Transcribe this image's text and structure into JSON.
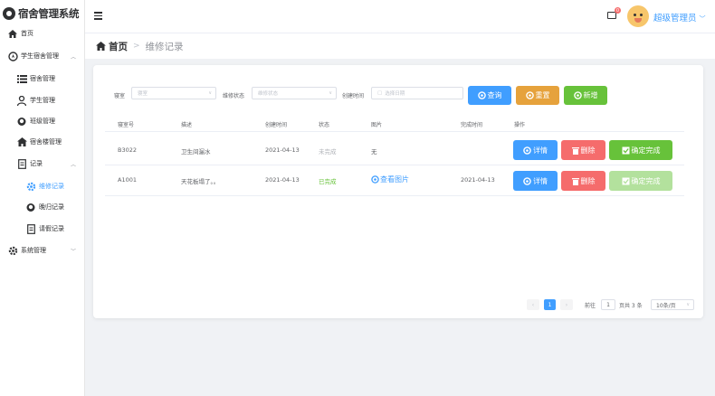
{
  "app": {
    "title": "宿舍管理系统"
  },
  "sidebar": {
    "items": [
      {
        "label": "首页"
      },
      {
        "label": "学生宿舍管理"
      },
      {
        "label": "宿舍管理"
      },
      {
        "label": "学生管理"
      },
      {
        "label": "班级管理"
      },
      {
        "label": "宿舍楼管理"
      },
      {
        "label": "记录"
      },
      {
        "label": "维修记录"
      },
      {
        "label": "晚归记录"
      },
      {
        "label": "请假记录"
      },
      {
        "label": "系统管理"
      }
    ]
  },
  "header": {
    "badge": "0",
    "user": "超级管理员"
  },
  "breadcrumb": {
    "home": "首页",
    "current": "维修记录"
  },
  "filters": {
    "room_label": "寝室",
    "room_placeholder": "寝室",
    "status_label": "维修状态",
    "status_placeholder": "维修状态",
    "date_label": "创建时间",
    "date_placeholder": "选择日期"
  },
  "actions": {
    "query": "查询",
    "reset": "重置",
    "add": "新增"
  },
  "table": {
    "headers": [
      "寝室号",
      "描述",
      "创建时间",
      "状态",
      "图片",
      "完成时间",
      "操作"
    ],
    "rows": [
      {
        "room": "B3022",
        "desc": "卫生间漏水",
        "created": "2021-04-13",
        "status": "未完成",
        "image": "无",
        "finished": ""
      },
      {
        "room": "A1001",
        "desc": "天花板塌了。。",
        "created": "2021-04-13",
        "status": "已完成",
        "image": "查看图片",
        "finished": "2021-04-13"
      }
    ],
    "row_actions": {
      "detail": "详情",
      "delete": "删除",
      "complete": "确定完成"
    }
  },
  "pagination": {
    "current": "1",
    "goto_label": "前往",
    "goto_value": "1",
    "total": "页共 3 条",
    "page_size": "10条/页"
  },
  "colors": {
    "primary": "#409eff",
    "warning": "#e6a23c",
    "success": "#67c23a",
    "danger": "#f56c6c",
    "success_disabled": "#b3e19d"
  }
}
